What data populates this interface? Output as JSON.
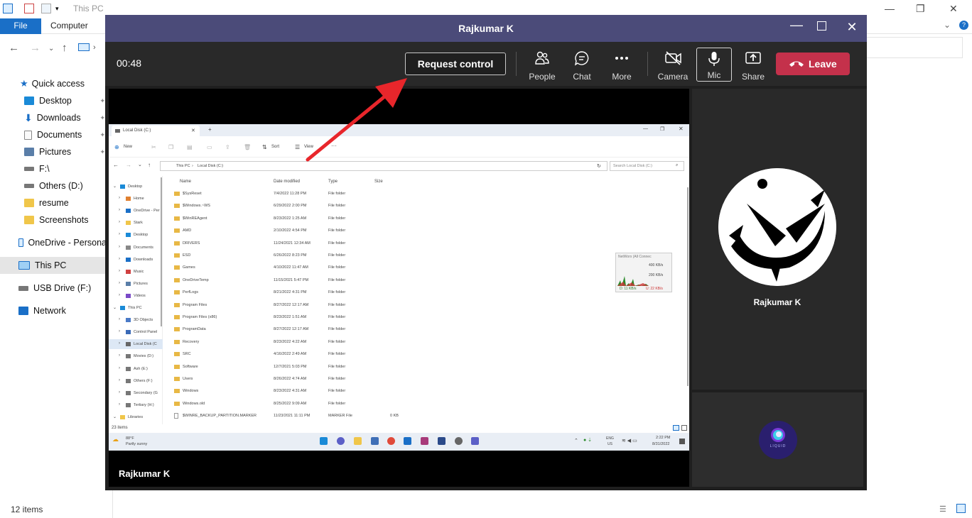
{
  "explorer": {
    "title": "This PC",
    "ribbon_tabs": [
      "File",
      "Computer"
    ],
    "sidebar": [
      {
        "label": "Quick access",
        "icon": "star-icon",
        "color": "#1a6fc7"
      },
      {
        "label": "Desktop",
        "icon": "desktop-icon",
        "color": "#1a8ad7"
      },
      {
        "label": "Downloads",
        "icon": "download-icon",
        "color": "#1a6fc7"
      },
      {
        "label": "Documents",
        "icon": "documents-icon",
        "color": "#8a8a8a"
      },
      {
        "label": "Pictures",
        "icon": "pictures-icon",
        "color": "#5a7ea8"
      },
      {
        "label": "F:\\",
        "icon": "drive-icon",
        "color": "#777777"
      },
      {
        "label": "Others (D:)",
        "icon": "drive-icon",
        "color": "#777777"
      },
      {
        "label": "resume",
        "icon": "folder-icon",
        "color": "#f0c64a"
      },
      {
        "label": "Screenshots",
        "icon": "folder-icon",
        "color": "#f0c64a"
      },
      {
        "label": "OneDrive - Persona",
        "icon": "onedrive-icon",
        "color": "#1a6fc7"
      },
      {
        "label": "This PC",
        "icon": "computer-icon",
        "color": "#1a8ad7"
      },
      {
        "label": "USB Drive (F:)",
        "icon": "usb-icon",
        "color": "#777777"
      },
      {
        "label": "Network",
        "icon": "network-icon",
        "color": "#1a6fc7"
      }
    ],
    "status": "12 items"
  },
  "teams": {
    "title": "Rajkumar K",
    "timer": "00:48",
    "request_control": "Request control",
    "toolbar": {
      "people": "People",
      "chat": "Chat",
      "more": "More",
      "camera": "Camera",
      "mic": "Mic",
      "share": "Share",
      "leave": "Leave"
    },
    "presenter_name": "Rajkumar K",
    "participant_name": "Rajkumar K",
    "self_avatar_text": "LIQUID",
    "colors": {
      "titlebar": "#4b4b79",
      "leave": "#c4314b",
      "arrow": "#e8262b"
    }
  },
  "shared_screen": {
    "tab_title": "Local Disk (C:)",
    "commands": [
      "New",
      "Sort",
      "View"
    ],
    "path": [
      "This PC",
      "Local Disk (C:)"
    ],
    "search_placeholder": "Search Local Disk (C:)",
    "columns": [
      "Name",
      "Date modified",
      "Type",
      "Size"
    ],
    "nav": [
      "Desktop",
      "Home",
      "OneDrive - Per",
      "Stark",
      "Desktop",
      "Documents",
      "Downloads",
      "Music",
      "Pictures",
      "Videos",
      "This PC",
      "3D Objects",
      "Control Panel",
      "Local Disk (C",
      "Movies (D:)",
      "Ash (E:)",
      "Others (F:)",
      "Secondary (G",
      "Tertiary (H:)",
      "Libraries"
    ],
    "files": [
      {
        "name": "$SysReset",
        "date": "7/4/2022 11:28 PM",
        "type": "File folder",
        "size": ""
      },
      {
        "name": "$Windows.~WS",
        "date": "6/29/2022 2:00 PM",
        "type": "File folder",
        "size": ""
      },
      {
        "name": "$WinREAgent",
        "date": "8/23/2022 1:25 AM",
        "type": "File folder",
        "size": ""
      },
      {
        "name": "AMD",
        "date": "2/10/2022 4:54 PM",
        "type": "File folder",
        "size": ""
      },
      {
        "name": "DRIVERS",
        "date": "11/24/2021 12:34 AM",
        "type": "File folder",
        "size": ""
      },
      {
        "name": "ESD",
        "date": "6/26/2022 8:23 PM",
        "type": "File folder",
        "size": ""
      },
      {
        "name": "Games",
        "date": "4/10/2022 11:47 AM",
        "type": "File folder",
        "size": ""
      },
      {
        "name": "OneDriveTemp",
        "date": "11/15/2021 5:47 PM",
        "type": "File folder",
        "size": ""
      },
      {
        "name": "PerfLogs",
        "date": "8/21/2022 4:31 PM",
        "type": "File folder",
        "size": ""
      },
      {
        "name": "Program Files",
        "date": "8/27/2022 12:17 AM",
        "type": "File folder",
        "size": ""
      },
      {
        "name": "Program Files (x86)",
        "date": "8/23/2022 1:51 AM",
        "type": "File folder",
        "size": ""
      },
      {
        "name": "ProgramData",
        "date": "8/27/2022 12:17 AM",
        "type": "File folder",
        "size": ""
      },
      {
        "name": "Recovery",
        "date": "8/23/2022 4:22 AM",
        "type": "File folder",
        "size": ""
      },
      {
        "name": "SRC",
        "date": "4/16/2022 2:49 AM",
        "type": "File folder",
        "size": ""
      },
      {
        "name": "Software",
        "date": "12/7/2021 5:03 PM",
        "type": "File folder",
        "size": ""
      },
      {
        "name": "Users",
        "date": "8/26/2022 4:74 AM",
        "type": "File folder",
        "size": ""
      },
      {
        "name": "Windows",
        "date": "8/23/2022 4:31 AM",
        "type": "File folder",
        "size": ""
      },
      {
        "name": "Windows.old",
        "date": "8/25/2022 9:09 AM",
        "type": "File folder",
        "size": ""
      },
      {
        "name": "$WINRE_BACKUP_PARTITION.MARKER",
        "date": "11/23/2021 11:11 PM",
        "type": "MARKER File",
        "size": "0 KB"
      }
    ],
    "status": "23 items",
    "net_widget": {
      "title": "NetWorx (All Connec",
      "up": "400 KB/s",
      "mid": "200 KB/s",
      "down_label": "D: 11 KB/s",
      "up_label": "U: 22 KB/s"
    },
    "taskbar": {
      "temp": "88°F",
      "weather": "Partly sunny",
      "lang": "ENG",
      "region": "US",
      "time": "2:22 PM",
      "date": "8/31/2022"
    }
  }
}
